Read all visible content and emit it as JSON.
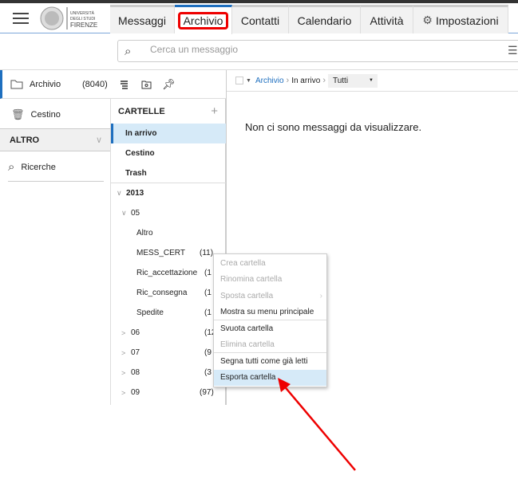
{
  "header": {
    "logo_text": "UNIVERSITÀ DEGLI STUDI FIRENZE",
    "tabs": [
      {
        "label": "Messaggi"
      },
      {
        "label": "Archivio",
        "active": true
      },
      {
        "label": "Contatti"
      },
      {
        "label": "Calendario"
      },
      {
        "label": "Attività"
      },
      {
        "label": "Impostazioni",
        "icon": "gear-icon"
      }
    ]
  },
  "search": {
    "placeholder": "Cerca un messaggio"
  },
  "sidebar": {
    "archive_label": "Archivio",
    "archive_count": "(8040)",
    "trash_label": "Cestino",
    "section_label": "ALTRO",
    "searches_label": "Ricerche"
  },
  "folders": {
    "header": "CARTELLE",
    "add": "+",
    "items": [
      {
        "label": "In arrivo",
        "bold": true,
        "selected": true,
        "level": 0
      },
      {
        "label": "Cestino",
        "bold": true,
        "level": 0
      },
      {
        "label": "Trash",
        "bold": true,
        "level": 0
      },
      {
        "label": "2013",
        "bold": true,
        "level": 0,
        "toggle": "expanded"
      },
      {
        "label": "05",
        "level": 1,
        "toggle": "expanded"
      },
      {
        "label": "Altro",
        "level": 2
      },
      {
        "label": "MESS_CERT",
        "level": 2,
        "count": "(11)"
      },
      {
        "label": "Ric_accettazione",
        "level": 2,
        "count": "(1"
      },
      {
        "label": "Ric_consegna",
        "level": 2,
        "count": "(1"
      },
      {
        "label": "Spedite",
        "level": 2,
        "count": "(1"
      },
      {
        "label": "06",
        "level": 1,
        "toggle": "collapsed",
        "count": "(12"
      },
      {
        "label": "07",
        "level": 1,
        "toggle": "collapsed",
        "count": "(9"
      },
      {
        "label": "08",
        "level": 1,
        "toggle": "collapsed",
        "count": "(3"
      },
      {
        "label": "09",
        "level": 1,
        "toggle": "collapsed",
        "count": "(97)"
      }
    ]
  },
  "breadcrumb": {
    "items": [
      "Archivio",
      "In arrivo"
    ],
    "filter": "Tutti"
  },
  "main": {
    "empty_message": "Non ci sono messaggi da visualizzare."
  },
  "context_menu": {
    "items": [
      {
        "label": "Crea cartella",
        "disabled": true
      },
      {
        "label": "Rinomina cartella",
        "disabled": true
      },
      {
        "label": "Sposta cartella",
        "disabled": true,
        "submenu": true
      },
      {
        "label": "Mostra su menu principale",
        "disabled": false,
        "sep_after": true
      },
      {
        "label": "Svuota cartella",
        "disabled": false
      },
      {
        "label": "Elimina cartella",
        "disabled": true,
        "sep_after": true
      },
      {
        "label": "Segna tutti come già letti",
        "disabled": false
      },
      {
        "label": "Esporta cartella",
        "disabled": false,
        "hover": true
      }
    ]
  },
  "colors": {
    "accent": "#1e6fbf",
    "selected": "#d6eaf8",
    "annotation": "#e00000"
  }
}
